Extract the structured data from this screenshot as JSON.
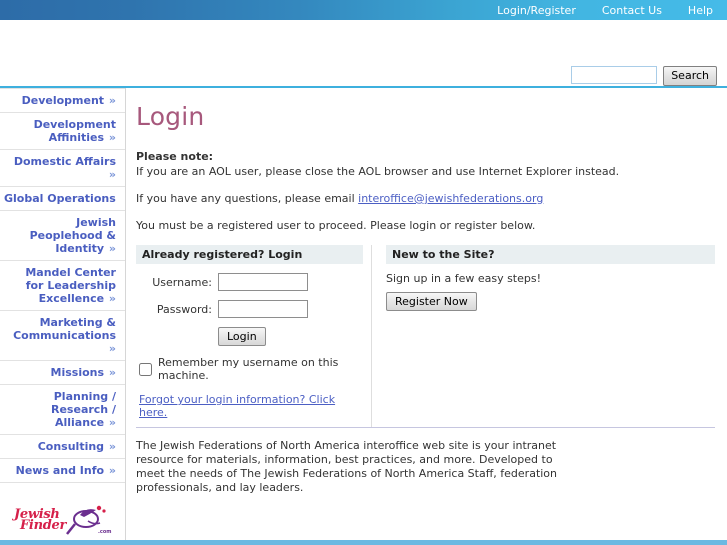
{
  "topnav": {
    "links": [
      {
        "label": "Login/Register"
      },
      {
        "label": "Contact Us"
      },
      {
        "label": "Help"
      }
    ]
  },
  "search": {
    "value": "",
    "placeholder": "",
    "button_label": "Search"
  },
  "sidebar": {
    "items": [
      {
        "label": "Development",
        "chevron": "»"
      },
      {
        "label": "Development Affinities",
        "chevron": "»"
      },
      {
        "label": "Domestic Affairs",
        "chevron": "»"
      },
      {
        "label": "Global Operations",
        "chevron": ""
      },
      {
        "label": "Jewish Peoplehood & Identity",
        "chevron": "»"
      },
      {
        "label": "Mandel Center for Leadership Excellence",
        "chevron": "»"
      },
      {
        "label": "Marketing & Communications",
        "chevron": "»"
      },
      {
        "label": "Missions",
        "chevron": "»"
      },
      {
        "label": "Planning / Research / Alliance",
        "chevron": "»"
      },
      {
        "label": "Consulting",
        "chevron": "»"
      },
      {
        "label": "News and Info",
        "chevron": "»"
      }
    ],
    "logo": {
      "line1": "Jewish",
      "line2": "Finder",
      "suffix": ".com"
    }
  },
  "main": {
    "title": "Login",
    "note_heading": "Please note:",
    "note_line": "If you are an AOL user, please close the AOL browser and use Internet Explorer instead.",
    "questions_prefix": "If you have any questions, please email ",
    "email_link": "interoffice@jewishfederations.org",
    "registered_user_line": "You must be a registered user to proceed. Please login or register below."
  },
  "login_panel": {
    "heading": "Already registered? Login",
    "username_label": "Username:",
    "username_value": "",
    "password_label": "Password:",
    "password_value": "",
    "login_button": "Login",
    "remember_label": "Remember my username on this machine.",
    "remember_checked": false,
    "forgot_link": "Forgot your login information? Click here."
  },
  "register_panel": {
    "heading": "New to the Site?",
    "signup_text": "Sign up in a few easy steps!",
    "register_button": "Register Now"
  },
  "footer": {
    "paragraph": "The Jewish Federations of North America interoffice web site is your intranet resource for materials, information, best practices, and more. Developed to meet the needs of The Jewish Federations of North America Staff, federation professionals, and lay leaders."
  },
  "colors": {
    "topbar_dark": "#2d6ca8",
    "topbar_light": "#45bbe8",
    "rule": "#3eb0de",
    "title": "#a7587c",
    "nav_text": "#4a5ec0",
    "link": "#4c5fc4",
    "panel_head_bg": "#e9eff1",
    "bottom_bar": "#6cb9e2"
  }
}
